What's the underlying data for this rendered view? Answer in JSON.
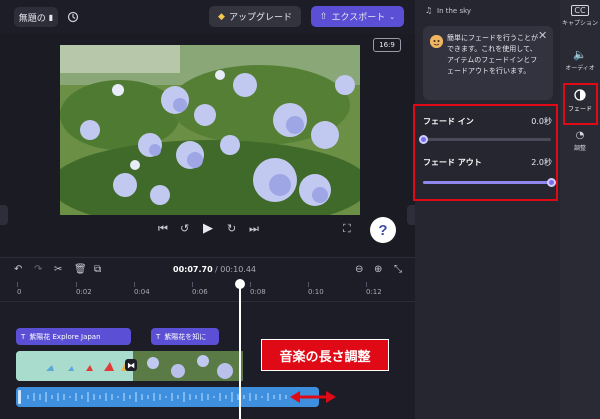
{
  "topbar": {
    "project_title": "無題の",
    "upgrade_label": "アップグレード",
    "export_label": "エクスポート",
    "accent": "#5b4fd6"
  },
  "preview": {
    "aspect_ratio": "16:9"
  },
  "timeline": {
    "current_time": "00:07.70",
    "total_time": "/ 00:10.44",
    "ruler_ticks": [
      "0",
      "0:02",
      "0:04",
      "0:06",
      "0:08",
      "0:10",
      "0:12"
    ],
    "text_clip_1": "紫陽花 Explore Japan",
    "text_clip_2": "紫陽花を知に",
    "annotation": "音楽の長さ調整",
    "annotation_color": "#e00a16"
  },
  "panel": {
    "audio_title": "In the sky",
    "tooltip_text": "簡単にフェードを行うことができます。これを使用して、アイテムのフェードインとフェードアウトを行います。",
    "fade_in_label": "フェード イン",
    "fade_in_value": "0.0秒",
    "fade_in_fraction": 0.0,
    "fade_out_label": "フェード アウト",
    "fade_out_value": "2.0秒",
    "fade_out_fraction": 1.0
  },
  "rail": {
    "caption_label": "キャプション",
    "audio_label": "オーディオ",
    "fade_label": "フェード",
    "speed_label": "調整"
  }
}
